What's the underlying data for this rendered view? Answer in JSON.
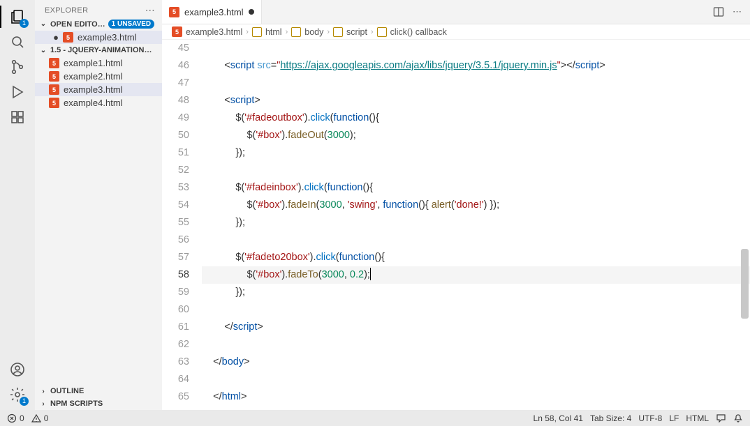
{
  "sidebar": {
    "title": "EXPLORER",
    "openEditorsLabel": "OPEN EDITO…",
    "unsavedBadge": "1 UNSAVED",
    "openEditor": "example3.html",
    "folderLabel": "1.5 - JQUERY-ANIMATION…",
    "files": [
      "example1.html",
      "example2.html",
      "example3.html",
      "example4.html"
    ],
    "activeFile": "example3.html",
    "outline": "OUTLINE",
    "npm": "NPM SCRIPTS"
  },
  "tab": {
    "label": "example3.html"
  },
  "breadcrumb": {
    "file": "example3.html",
    "parts": [
      "html",
      "body",
      "script",
      "click() callback"
    ]
  },
  "code": {
    "startLine": 45,
    "currentLine": 58,
    "scriptUrl": "https://ajax.googleapis.com/ajax/libs/jquery/3.5.1/jquery.min.js",
    "selectors": {
      "fadeOut": "#fadeoutbox",
      "fadeIn": "#fadeinbox",
      "fadeTo": "#fadeto20box",
      "box": "#box"
    },
    "args": {
      "duration": "3000",
      "easing": "swing",
      "alert": "done!",
      "opacity": "0.2"
    }
  },
  "status": {
    "errors": "0",
    "warnings": "0",
    "cursor": "Ln 58, Col 41",
    "tabSize": "Tab Size: 4",
    "encoding": "UTF-8",
    "eol": "LF",
    "lang": "HTML"
  },
  "activity": {
    "explorerBadge": "1",
    "settingsBadge": "1"
  }
}
